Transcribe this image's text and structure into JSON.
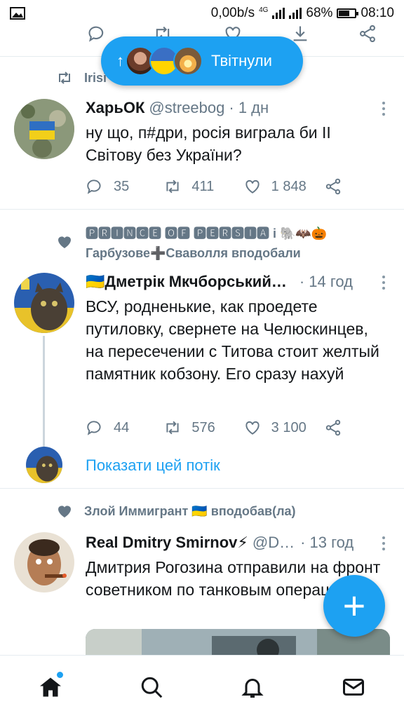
{
  "status_bar": {
    "network_speed": "0,00b/s",
    "network_type": "4G",
    "battery_percent": "68%",
    "battery_level": 0.68,
    "time": "08:10"
  },
  "new_tweets_pill": {
    "label": "Твітнули",
    "arrow": "↑"
  },
  "tweets": [
    {
      "context": "Irisі",
      "context_icon": "retweet-icon",
      "name": "ХарьОК",
      "handle": "@streebog",
      "time": "· 1 дн",
      "text": "ну що, п#дри, росія виграла би ІІ Світову без України?",
      "replies": "35",
      "retweets": "411",
      "likes": "1 848"
    },
    {
      "context_line1": "🅿🆁🅸🅽🅲🅴 🅾🅵 🅿🅴🆁🆂🅸🅰 і 🐘🦇🎃",
      "context_line2": "Гарбузове➕Сваволля вподобали",
      "context_icon": "heart-icon",
      "name": "🇺🇦Дметрік Мкчборський…",
      "time": "· 14 год",
      "text": "ВСУ, родненькие, как проедете путиловку, свернете на Челюскинцев, на пересечении с Титова стоит желтый памятник кобзону. Его сразу нахуй",
      "replies": "44",
      "retweets": "576",
      "likes": "3 100",
      "show_thread": "Показати цей потік"
    },
    {
      "context": "Злой Иммигрант 🇺🇦 вподобав(ла)",
      "context_icon": "heart-icon",
      "name": "Real Dmitry Smirnov⚡",
      "handle": "@D…",
      "time": "· 13 год",
      "text": "Дмитрия Рогозина отправили на фронт советником по танковым операциям."
    }
  ],
  "fab": {
    "label": "+"
  },
  "bottom_nav": [
    "home-icon",
    "search-icon",
    "notifications-icon",
    "messages-icon"
  ],
  "colors": {
    "accent": "#1da1f2",
    "secondary_text": "#657786",
    "text": "#14171a"
  }
}
